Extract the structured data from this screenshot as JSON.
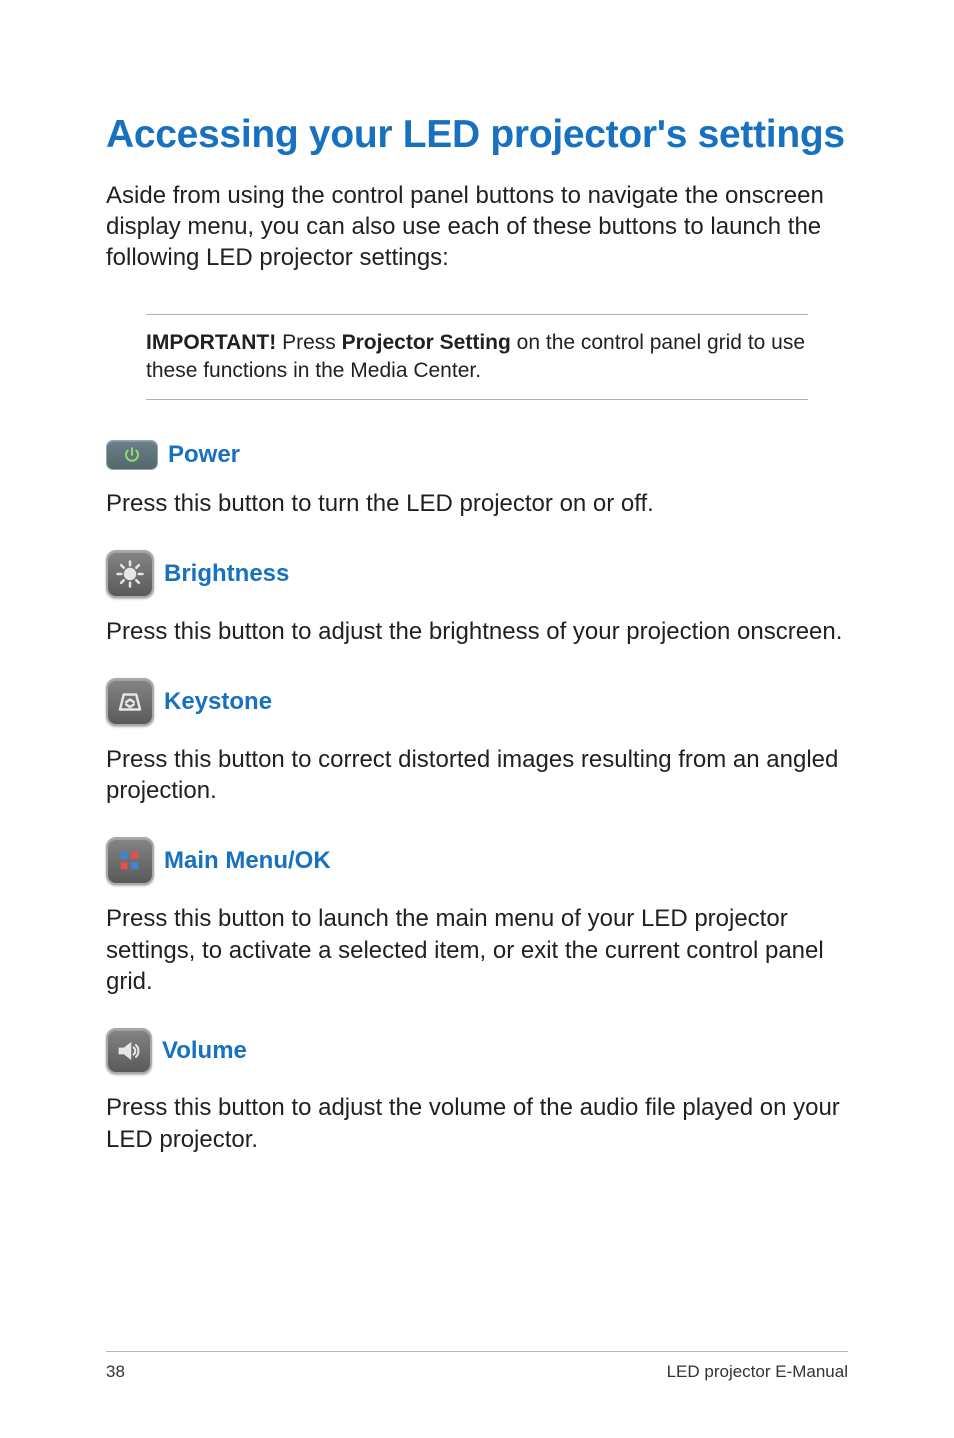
{
  "title": "Accessing your LED projector's settings",
  "intro": "Aside from using the control panel buttons to navigate the onscreen display menu, you can also use each of these buttons to launch the following LED projector settings:",
  "important": {
    "label": "IMPORTANT!",
    "before": " Press ",
    "strong": "Projector Setting",
    "after": " on the control panel grid to use these functions in the Media Center."
  },
  "settings": [
    {
      "name": "Power",
      "desc": "Press this button to turn the LED projector on or off."
    },
    {
      "name": "Brightness",
      "desc": "Press this button to adjust the brightness of your projection onscreen."
    },
    {
      "name": "Keystone",
      "desc": "Press this button to correct distorted images resulting from an angled projection."
    },
    {
      "name": "Main Menu/OK",
      "desc": "Press this button to launch the main menu of your LED projector settings, to activate a selected item, or exit the current control panel grid."
    },
    {
      "name": "Volume",
      "desc": "Press this button to adjust the volume of the audio file played on your LED projector."
    }
  ],
  "footer": {
    "page_number": "38",
    "doc_title": "LED projector E-Manual"
  },
  "icons": {
    "power": "power-icon",
    "brightness": "brightness-icon",
    "keystone": "keystone-icon",
    "main_menu": "grid-icon",
    "volume": "volume-icon"
  }
}
